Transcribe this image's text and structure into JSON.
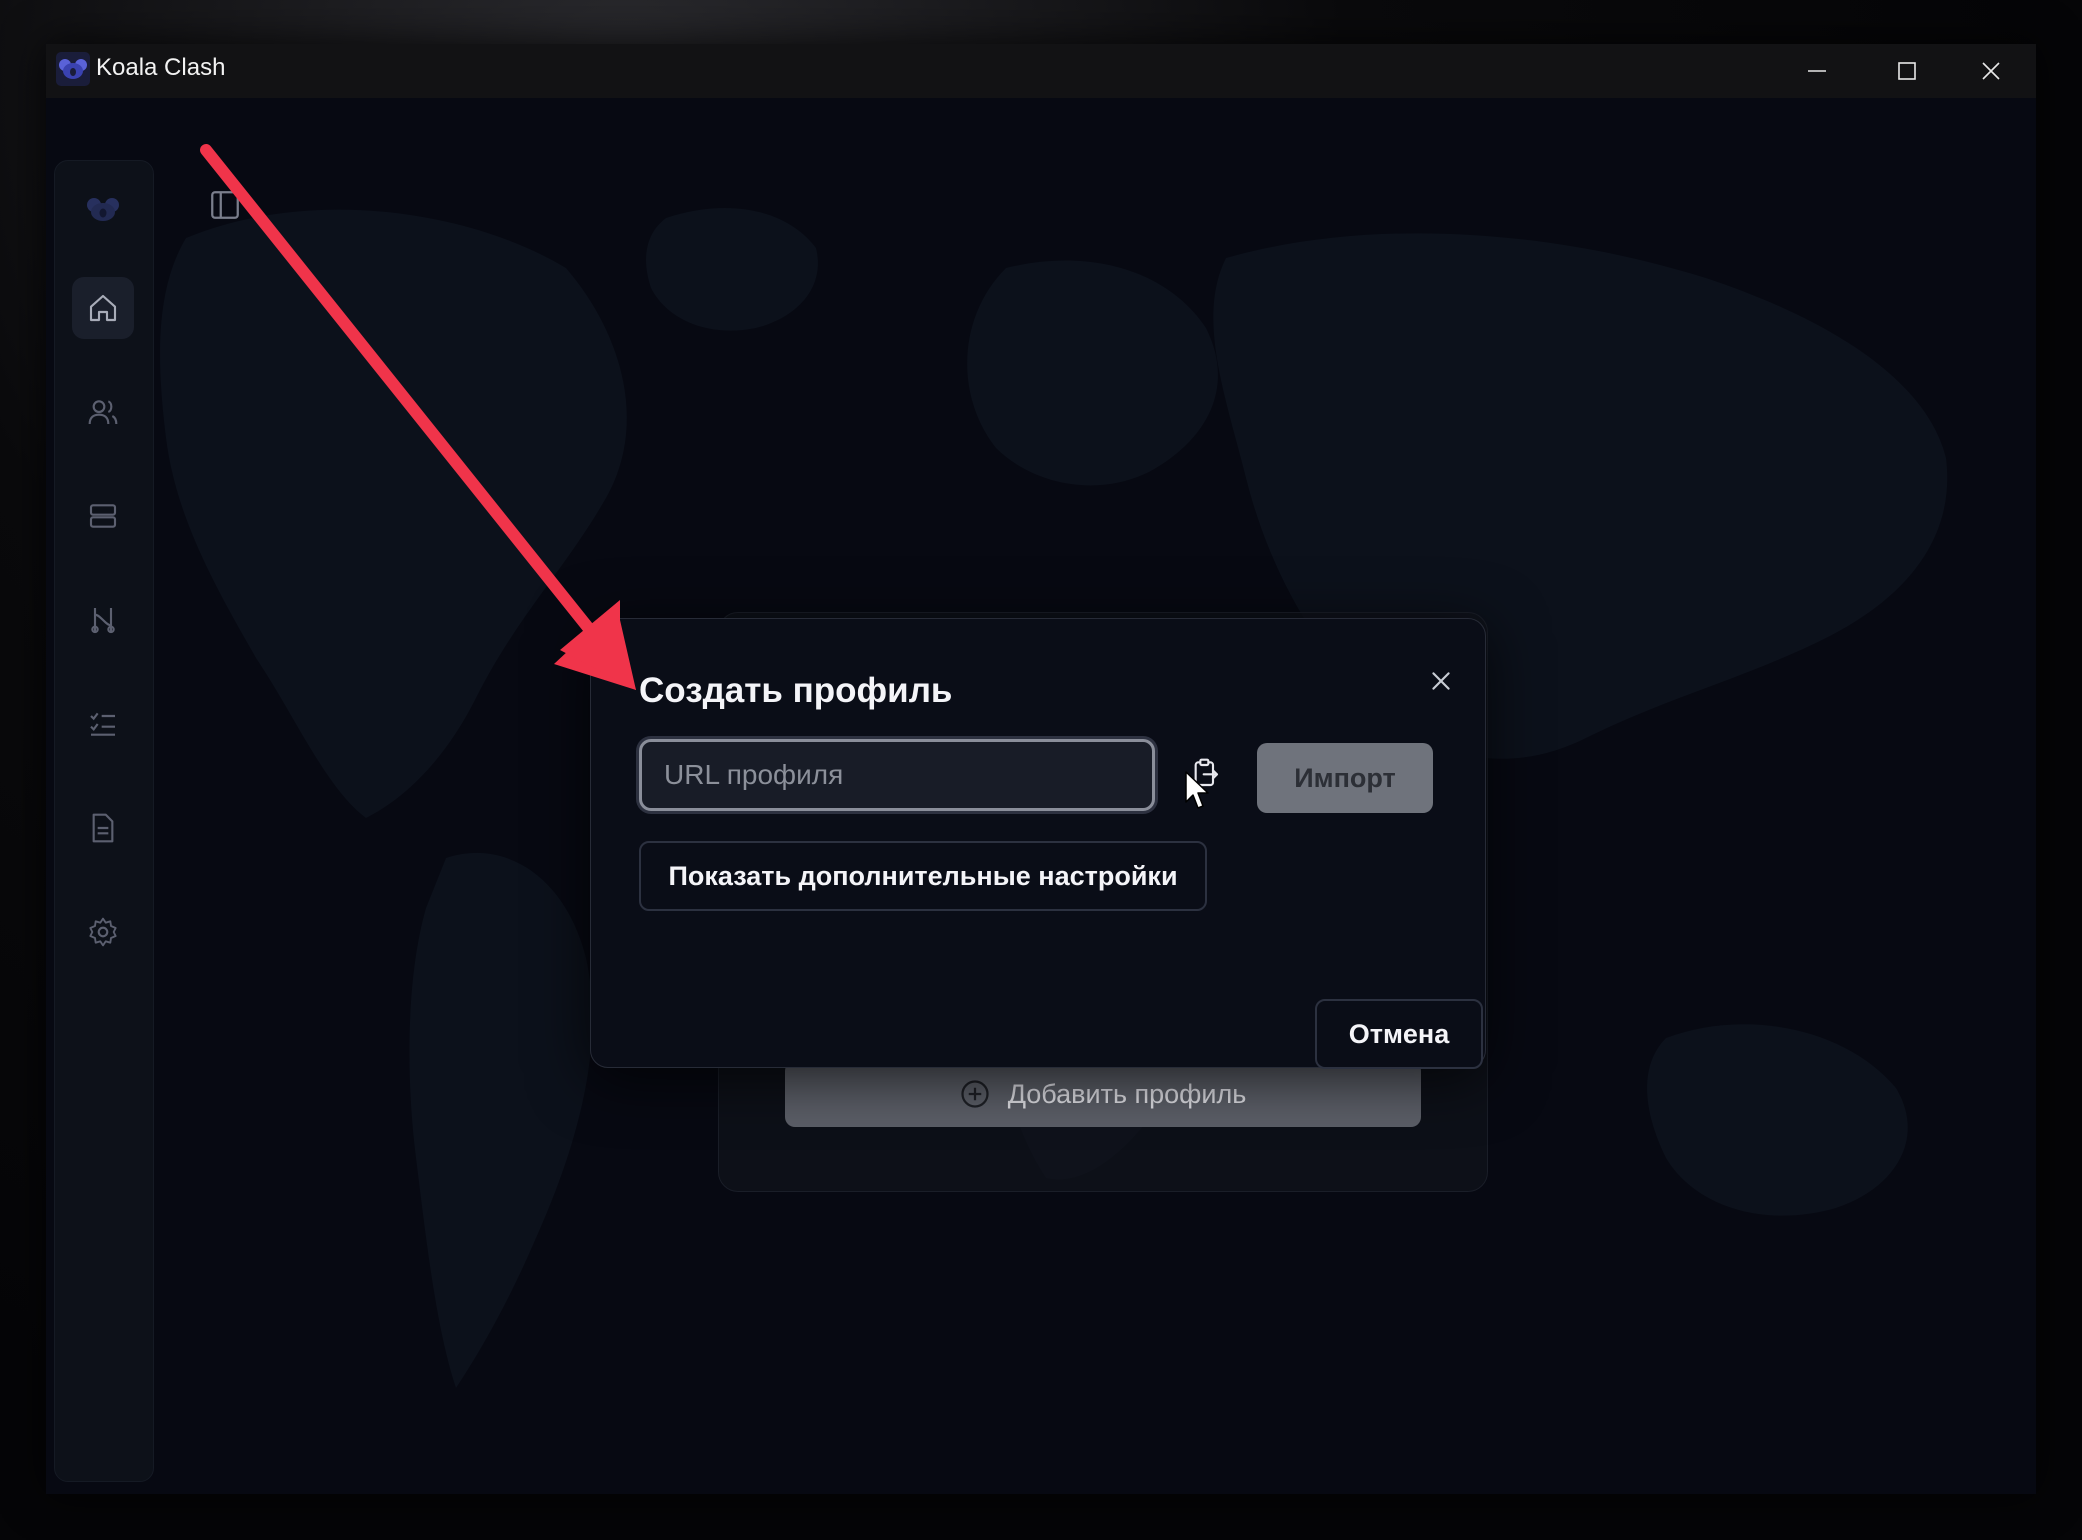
{
  "window": {
    "title": "Koala Clash",
    "controls": [
      "minimize-icon",
      "maximize-icon",
      "close-icon"
    ]
  },
  "sidebar": {
    "items": [
      {
        "id": "home",
        "icon": "home-icon",
        "active": true
      },
      {
        "id": "profiles",
        "icon": "users-icon",
        "active": false
      },
      {
        "id": "proxies",
        "icon": "server-icon",
        "active": false
      },
      {
        "id": "connections",
        "icon": "routing-icon",
        "active": false
      },
      {
        "id": "rules",
        "icon": "list-check-icon",
        "active": false
      },
      {
        "id": "logs",
        "icon": "file-text-icon",
        "active": false
      },
      {
        "id": "settings",
        "icon": "gear-icon",
        "active": false
      }
    ]
  },
  "background_card": {
    "add_profile_label": "Добавить профиль"
  },
  "dialog": {
    "title": "Создать профиль",
    "url_placeholder": "URL профиля",
    "url_value": "",
    "import_label": "Импорт",
    "advanced_label": "Показать дополнительные настройки",
    "cancel_label": "Отмена"
  },
  "colors": {
    "background": "#070912",
    "dialog": "#0a0d17",
    "accent_arrow": "#f0344a",
    "import_disabled": "#6f737c"
  }
}
